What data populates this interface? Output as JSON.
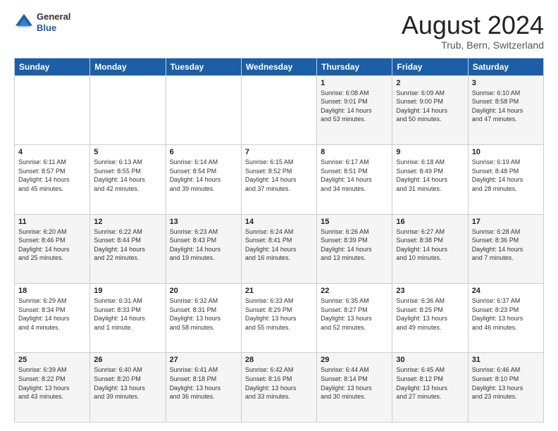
{
  "header": {
    "logo_line1": "General",
    "logo_line2": "Blue",
    "month_title": "August 2024",
    "location": "Trub, Bern, Switzerland"
  },
  "weekdays": [
    "Sunday",
    "Monday",
    "Tuesday",
    "Wednesday",
    "Thursday",
    "Friday",
    "Saturday"
  ],
  "weeks": [
    [
      {
        "day": "",
        "text": ""
      },
      {
        "day": "",
        "text": ""
      },
      {
        "day": "",
        "text": ""
      },
      {
        "day": "",
        "text": ""
      },
      {
        "day": "1",
        "text": "Sunrise: 6:08 AM\nSunset: 9:01 PM\nDaylight: 14 hours\nand 53 minutes."
      },
      {
        "day": "2",
        "text": "Sunrise: 6:09 AM\nSunset: 9:00 PM\nDaylight: 14 hours\nand 50 minutes."
      },
      {
        "day": "3",
        "text": "Sunrise: 6:10 AM\nSunset: 8:58 PM\nDaylight: 14 hours\nand 47 minutes."
      }
    ],
    [
      {
        "day": "4",
        "text": "Sunrise: 6:11 AM\nSunset: 8:57 PM\nDaylight: 14 hours\nand 45 minutes."
      },
      {
        "day": "5",
        "text": "Sunrise: 6:13 AM\nSunset: 8:55 PM\nDaylight: 14 hours\nand 42 minutes."
      },
      {
        "day": "6",
        "text": "Sunrise: 6:14 AM\nSunset: 8:54 PM\nDaylight: 14 hours\nand 39 minutes."
      },
      {
        "day": "7",
        "text": "Sunrise: 6:15 AM\nSunset: 8:52 PM\nDaylight: 14 hours\nand 37 minutes."
      },
      {
        "day": "8",
        "text": "Sunrise: 6:17 AM\nSunset: 8:51 PM\nDaylight: 14 hours\nand 34 minutes."
      },
      {
        "day": "9",
        "text": "Sunrise: 6:18 AM\nSunset: 8:49 PM\nDaylight: 14 hours\nand 31 minutes."
      },
      {
        "day": "10",
        "text": "Sunrise: 6:19 AM\nSunset: 8:48 PM\nDaylight: 14 hours\nand 28 minutes."
      }
    ],
    [
      {
        "day": "11",
        "text": "Sunrise: 6:20 AM\nSunset: 8:46 PM\nDaylight: 14 hours\nand 25 minutes."
      },
      {
        "day": "12",
        "text": "Sunrise: 6:22 AM\nSunset: 8:44 PM\nDaylight: 14 hours\nand 22 minutes."
      },
      {
        "day": "13",
        "text": "Sunrise: 6:23 AM\nSunset: 8:43 PM\nDaylight: 14 hours\nand 19 minutes."
      },
      {
        "day": "14",
        "text": "Sunrise: 6:24 AM\nSunset: 8:41 PM\nDaylight: 14 hours\nand 16 minutes."
      },
      {
        "day": "15",
        "text": "Sunrise: 6:26 AM\nSunset: 8:39 PM\nDaylight: 14 hours\nand 13 minutes."
      },
      {
        "day": "16",
        "text": "Sunrise: 6:27 AM\nSunset: 8:38 PM\nDaylight: 14 hours\nand 10 minutes."
      },
      {
        "day": "17",
        "text": "Sunrise: 6:28 AM\nSunset: 8:36 PM\nDaylight: 14 hours\nand 7 minutes."
      }
    ],
    [
      {
        "day": "18",
        "text": "Sunrise: 6:29 AM\nSunset: 8:34 PM\nDaylight: 14 hours\nand 4 minutes."
      },
      {
        "day": "19",
        "text": "Sunrise: 6:31 AM\nSunset: 8:33 PM\nDaylight: 14 hours\nand 1 minute."
      },
      {
        "day": "20",
        "text": "Sunrise: 6:32 AM\nSunset: 8:31 PM\nDaylight: 13 hours\nand 58 minutes."
      },
      {
        "day": "21",
        "text": "Sunrise: 6:33 AM\nSunset: 8:29 PM\nDaylight: 13 hours\nand 55 minutes."
      },
      {
        "day": "22",
        "text": "Sunrise: 6:35 AM\nSunset: 8:27 PM\nDaylight: 13 hours\nand 52 minutes."
      },
      {
        "day": "23",
        "text": "Sunrise: 6:36 AM\nSunset: 8:25 PM\nDaylight: 13 hours\nand 49 minutes."
      },
      {
        "day": "24",
        "text": "Sunrise: 6:37 AM\nSunset: 8:23 PM\nDaylight: 13 hours\nand 46 minutes."
      }
    ],
    [
      {
        "day": "25",
        "text": "Sunrise: 6:39 AM\nSunset: 8:22 PM\nDaylight: 13 hours\nand 43 minutes."
      },
      {
        "day": "26",
        "text": "Sunrise: 6:40 AM\nSunset: 8:20 PM\nDaylight: 13 hours\nand 39 minutes."
      },
      {
        "day": "27",
        "text": "Sunrise: 6:41 AM\nSunset: 8:18 PM\nDaylight: 13 hours\nand 36 minutes."
      },
      {
        "day": "28",
        "text": "Sunrise: 6:42 AM\nSunset: 8:16 PM\nDaylight: 13 hours\nand 33 minutes."
      },
      {
        "day": "29",
        "text": "Sunrise: 6:44 AM\nSunset: 8:14 PM\nDaylight: 13 hours\nand 30 minutes."
      },
      {
        "day": "30",
        "text": "Sunrise: 6:45 AM\nSunset: 8:12 PM\nDaylight: 13 hours\nand 27 minutes."
      },
      {
        "day": "31",
        "text": "Sunrise: 6:46 AM\nSunset: 8:10 PM\nDaylight: 13 hours\nand 23 minutes."
      }
    ]
  ]
}
